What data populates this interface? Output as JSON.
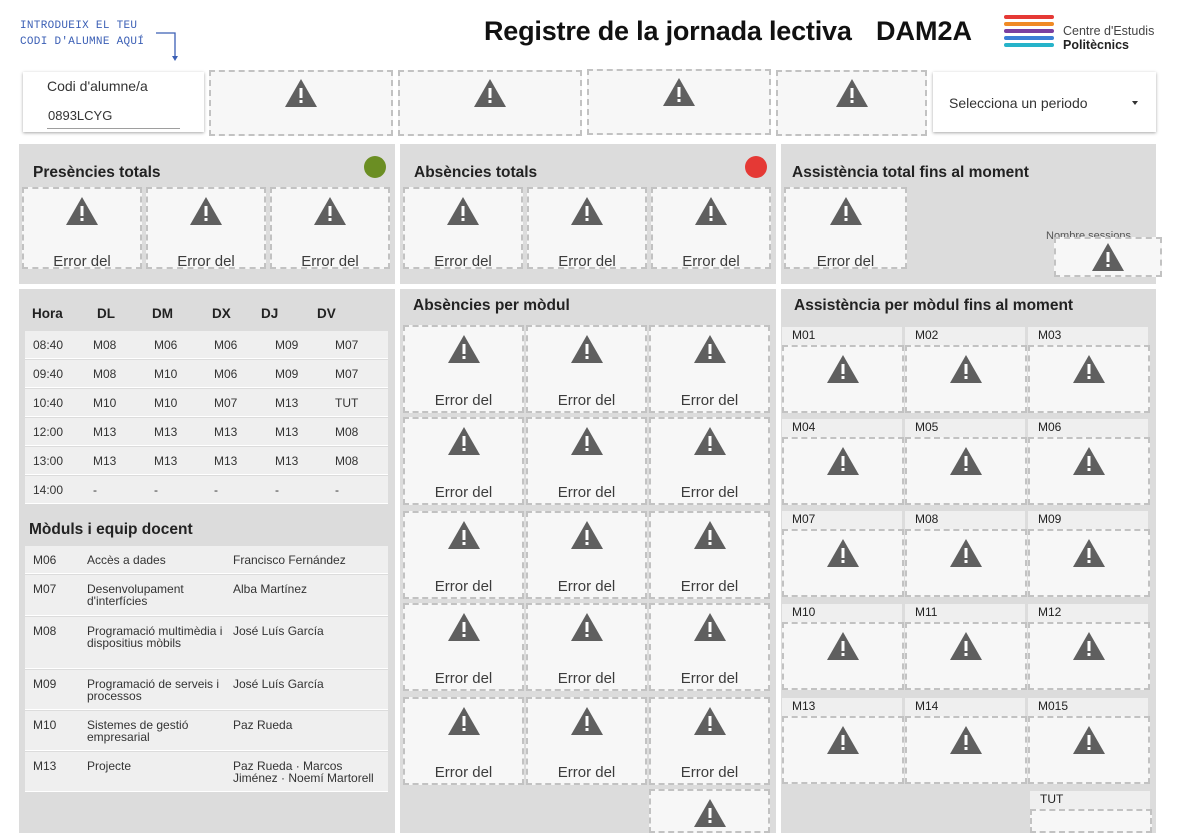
{
  "header": {
    "hint_line1": "INTRODUEIX EL TEU",
    "hint_line2": "CODI D'ALUMNE AQUÍ",
    "title": "Registre de la jornada lectiva",
    "class_code": "DAM2A",
    "logo_line1": "Centre d'Estudis",
    "logo_line2": "Politècnics"
  },
  "filters": {
    "code_label": "Codi d'alumne/a",
    "code_value": "0893LCYG",
    "period_label": "Selecciona un periodo"
  },
  "error_text": "Error del",
  "summary": {
    "presences_title": "Presències totals",
    "presences_color": "#6b8e23",
    "absences_title": "Absències totals",
    "absences_color": "#e53935",
    "attendance_title": "Assistència total fins al moment",
    "sessions_label": "Nombre sessions"
  },
  "schedule": {
    "headers": [
      "Hora",
      "DL",
      "DM",
      "DX",
      "DJ",
      "DV"
    ],
    "rows": [
      [
        "08:40",
        "M08",
        "M06",
        "M06",
        "M09",
        "M07"
      ],
      [
        "09:40",
        "M08",
        "M10",
        "M06",
        "M09",
        "M07"
      ],
      [
        "10:40",
        "M10",
        "M10",
        "M07",
        "M13",
        "TUT"
      ],
      [
        "12:00",
        "M13",
        "M13",
        "M13",
        "M13",
        "M08"
      ],
      [
        "13:00",
        "M13",
        "M13",
        "M13",
        "M13",
        "M08"
      ],
      [
        "14:00",
        "-",
        "-",
        "-",
        "-",
        "-"
      ]
    ]
  },
  "teachers": {
    "title": "Mòduls i equip docent",
    "rows": [
      {
        "code": "M06",
        "module": "Accès a dades",
        "teacher": "Francisco Fernández"
      },
      {
        "code": "M07",
        "module": "Desenvolupament d'interfícies",
        "teacher": "Alba Martínez"
      },
      {
        "code": "M08",
        "module": "Programació multimèdia i dispositius mòbils",
        "teacher": "José Luís García"
      },
      {
        "code": "M09",
        "module": "Programació de serveis i processos",
        "teacher": "José Luís García"
      },
      {
        "code": "M10",
        "module": "Sistemes de gestió empresarial",
        "teacher": "Paz Rueda"
      },
      {
        "code": "M13",
        "module": "Projecte",
        "teacher": "Paz Rueda · Marcos Jiménez · Noemí Martorell"
      }
    ]
  },
  "absences_module": {
    "title": "Absències per mòdul"
  },
  "attendance_module": {
    "title": "Assistència per mòdul fins al moment",
    "modules": [
      "M01",
      "M02",
      "M03",
      "M04",
      "M05",
      "M06",
      "M07",
      "M08",
      "M09",
      "M10",
      "M11",
      "M12",
      "M13",
      "M14",
      "M015",
      "TUT"
    ]
  }
}
